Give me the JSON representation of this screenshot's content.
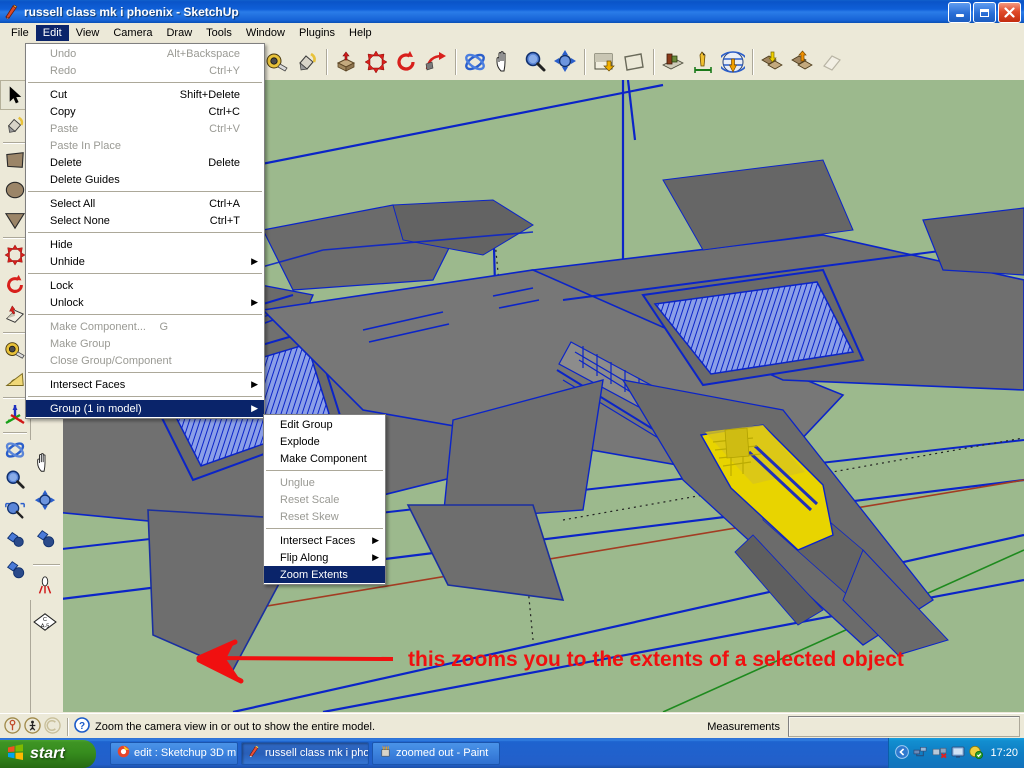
{
  "window": {
    "title": "russell class mk i phoenix - SketchUp",
    "app_icon": "sketchup-icon",
    "buttons": {
      "minimize": "_",
      "maximize": "❐",
      "close": "✕"
    }
  },
  "menubar": {
    "items": [
      {
        "label": "File",
        "open": false
      },
      {
        "label": "Edit",
        "open": true
      },
      {
        "label": "View",
        "open": false
      },
      {
        "label": "Camera",
        "open": false
      },
      {
        "label": "Draw",
        "open": false
      },
      {
        "label": "Tools",
        "open": false
      },
      {
        "label": "Window",
        "open": false
      },
      {
        "label": "Plugins",
        "open": false
      },
      {
        "label": "Help",
        "open": false
      }
    ]
  },
  "edit_menu": {
    "items": [
      {
        "label": "Undo",
        "accel": "Alt+Backspace",
        "disabled": true,
        "submenu": false,
        "highlighted": false
      },
      {
        "label": "Redo",
        "accel": "Ctrl+Y",
        "disabled": true,
        "submenu": false,
        "highlighted": false
      },
      {
        "divider": true
      },
      {
        "label": "Cut",
        "accel": "Shift+Delete",
        "disabled": false,
        "submenu": false,
        "highlighted": false
      },
      {
        "label": "Copy",
        "accel": "Ctrl+C",
        "disabled": false,
        "submenu": false,
        "highlighted": false
      },
      {
        "label": "Paste",
        "accel": "Ctrl+V",
        "disabled": true,
        "submenu": false,
        "highlighted": false
      },
      {
        "label": "Paste In Place",
        "accel": "",
        "disabled": true,
        "submenu": false,
        "highlighted": false
      },
      {
        "label": "Delete",
        "accel": "Delete",
        "disabled": false,
        "submenu": false,
        "highlighted": false
      },
      {
        "label": "Delete Guides",
        "accel": "",
        "disabled": false,
        "submenu": false,
        "highlighted": false
      },
      {
        "divider": true
      },
      {
        "label": "Select All",
        "accel": "Ctrl+A",
        "disabled": false,
        "submenu": false,
        "highlighted": false
      },
      {
        "label": "Select None",
        "accel": "Ctrl+T",
        "disabled": false,
        "submenu": false,
        "highlighted": false
      },
      {
        "divider": true
      },
      {
        "label": "Hide",
        "accel": "",
        "disabled": false,
        "submenu": false,
        "highlighted": false
      },
      {
        "label": "Unhide",
        "accel": "",
        "disabled": false,
        "submenu": true,
        "highlighted": false
      },
      {
        "divider": true
      },
      {
        "label": "Lock",
        "accel": "",
        "disabled": false,
        "submenu": false,
        "highlighted": false
      },
      {
        "label": "Unlock",
        "accel": "",
        "disabled": false,
        "submenu": true,
        "highlighted": false
      },
      {
        "divider": true
      },
      {
        "label": "Make Component...",
        "accel": "G",
        "disabled": true,
        "submenu": false,
        "highlighted": false
      },
      {
        "label": "Make Group",
        "accel": "",
        "disabled": true,
        "submenu": false,
        "highlighted": false
      },
      {
        "label": "Close Group/Component",
        "accel": "",
        "disabled": true,
        "submenu": false,
        "highlighted": false
      },
      {
        "divider": true
      },
      {
        "label": "Intersect Faces",
        "accel": "",
        "disabled": false,
        "submenu": true,
        "highlighted": false
      },
      {
        "divider": true
      },
      {
        "label": "Group (1 in model)",
        "accel": "",
        "disabled": false,
        "submenu": true,
        "highlighted": true
      }
    ]
  },
  "group_submenu": {
    "items": [
      {
        "label": "Edit Group",
        "disabled": false,
        "submenu": false,
        "highlighted": false
      },
      {
        "label": "Explode",
        "disabled": false,
        "submenu": false,
        "highlighted": false
      },
      {
        "label": "Make Component",
        "disabled": false,
        "submenu": false,
        "highlighted": false
      },
      {
        "divider": true
      },
      {
        "label": "Unglue",
        "disabled": true,
        "submenu": false,
        "highlighted": false
      },
      {
        "label": "Reset Scale",
        "disabled": true,
        "submenu": false,
        "highlighted": false
      },
      {
        "label": "Reset Skew",
        "disabled": true,
        "submenu": false,
        "highlighted": false
      },
      {
        "divider": true
      },
      {
        "label": "Intersect Faces",
        "disabled": false,
        "submenu": true,
        "highlighted": false
      },
      {
        "label": "Flip Along",
        "disabled": false,
        "submenu": true,
        "highlighted": false
      },
      {
        "label": "Zoom Extents",
        "disabled": false,
        "submenu": false,
        "highlighted": true
      }
    ]
  },
  "toolbar_top": {
    "groups": [
      [
        "tape-measure-icon",
        "paint-bucket-icon"
      ],
      [
        "push-pull-icon",
        "move-icon",
        "rotate-icon",
        "follow-me-icon"
      ],
      [
        "orbit-icon",
        "pan-icon",
        "zoom-icon",
        "zoom-extents-icon"
      ],
      [
        "section-plane-icon",
        "section-display-icon"
      ],
      [
        "materials-browser-icon",
        "dimension-icon",
        "globe-icon"
      ],
      [
        "get-models-icon",
        "share-model-icon",
        "model-info-icon"
      ]
    ]
  },
  "toolbar_left": {
    "column1": [
      "select-arrow-icon",
      "paint-bucket-icon",
      "rectangle-icon",
      "circle-icon",
      "polygon-icon",
      "move-icon",
      "rotate-icon",
      "follow-me-icon",
      "tape-measure-icon",
      "protractor-icon",
      "axes-icon",
      "orbit-icon",
      "zoom-icon",
      "zoom-window-icon",
      "position-camera-icon",
      "walk-icon"
    ],
    "column2": [
      "pan-icon",
      "zoom-extents-icon",
      "look-around-icon",
      "walk-icon",
      "section-plane-icon"
    ]
  },
  "viewport": {
    "background_color": "#9cb98d",
    "model_color": "#6f6f6f",
    "selection_edge_color": "#0b24c8",
    "canopy_color": "#e8d400",
    "axis_red": "#b03020",
    "axis_green": "#209020",
    "annotation": {
      "text": "this zooms you to the extents of a selected object",
      "color": "#f01010",
      "arrow": "left-arrow-annotation"
    }
  },
  "statusbar": {
    "icons": [
      "geo-location-icon",
      "person-icon",
      "credits-icon"
    ],
    "help_icon": "question-mark-icon",
    "message": "Zoom the camera view in or out to show the entire model.",
    "measurements_label": "Measurements",
    "measurements_value": ""
  },
  "taskbar": {
    "start_label": "start",
    "start_icon": "windows-flag-icon",
    "tasks": [
      {
        "label": "edit : Sketchup 3D m...",
        "icon": "browser-icon",
        "active": false
      },
      {
        "label": "russell class mk i phoe...",
        "icon": "sketchup-icon",
        "active": true
      },
      {
        "label": "zoomed out - Paint",
        "icon": "paint-icon",
        "active": false
      }
    ],
    "tray": {
      "icons": [
        "show-hidden-icons-icon",
        "network-icon",
        "antivirus-icon",
        "display-icon",
        "updates-icon"
      ],
      "clock": "17:20"
    }
  }
}
